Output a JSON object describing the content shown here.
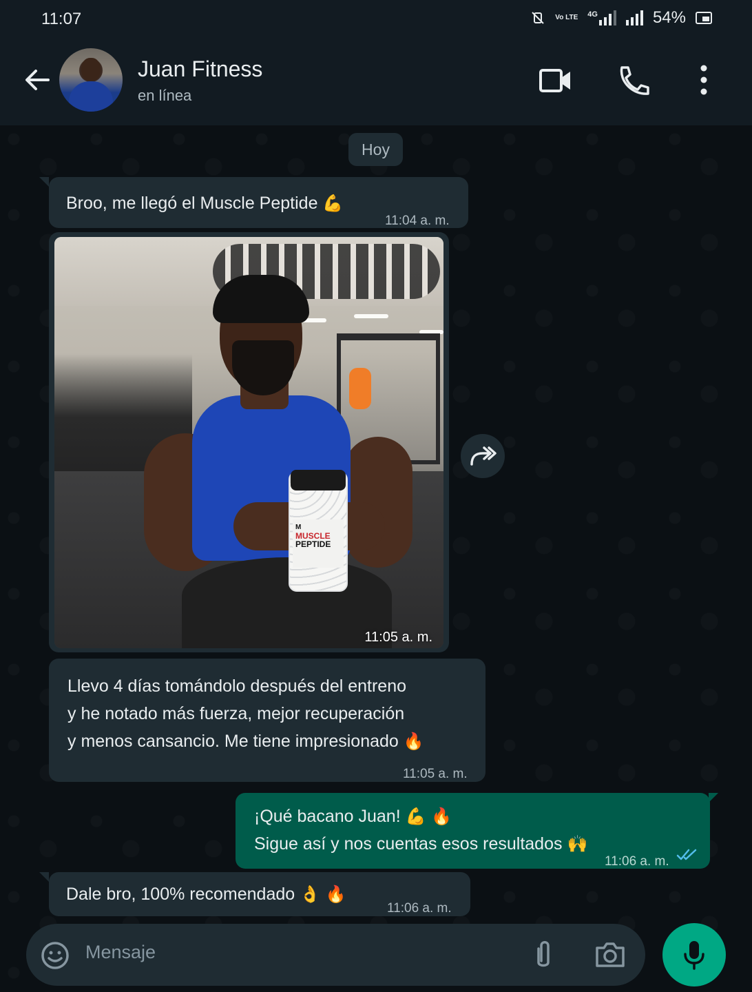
{
  "status_bar": {
    "time": "11:07",
    "network": "4G",
    "volte": "Vo LTE",
    "battery": "54%"
  },
  "header": {
    "contact_name": "Juan Fitness",
    "contact_status": "en línea"
  },
  "date_chip": "Hoy",
  "messages": [
    {
      "direction": "in",
      "text": "Broo, me llegó el Muscle Peptide",
      "emoji": "💪",
      "time": "11:04 a. m."
    },
    {
      "direction": "in",
      "type": "image",
      "time": "11:05 a. m.",
      "product_label": {
        "line1": "MUSCLE",
        "line2": "PEPTIDE"
      }
    },
    {
      "direction": "in",
      "lines": [
        "Llevo 4 días tomándolo después del entreno",
        "y he notado más fuerza, mejor recuperación",
        "y menos cansancio. Me tiene impresionado"
      ],
      "emoji": "🔥",
      "time": "11:05 a. m."
    },
    {
      "direction": "out",
      "lines": [
        "¡Qué bacano Juan!",
        "Sigue así y nos cuentas esos resultados"
      ],
      "emoji1": "💪 🔥",
      "emoji2": "🙌",
      "time": "11:06 a. m.",
      "status": "read"
    },
    {
      "direction": "in",
      "text": "Dale bro, 100% recomendado",
      "emoji": "👌 🔥",
      "time": "11:06 a. m."
    }
  ],
  "input": {
    "placeholder": "Mensaje"
  },
  "colors": {
    "header_bg": "#121b22",
    "chat_bg": "#0b1014",
    "incoming_bubble": "#1f2c33",
    "outgoing_bubble": "#005c4b",
    "accent": "#00a884",
    "read_ticks": "#53bdeb"
  },
  "icons": [
    "back-arrow-icon",
    "video-call-icon",
    "phone-icon",
    "more-vert-icon",
    "forward-icon",
    "emoji-icon",
    "attach-icon",
    "camera-icon",
    "mic-icon"
  ]
}
